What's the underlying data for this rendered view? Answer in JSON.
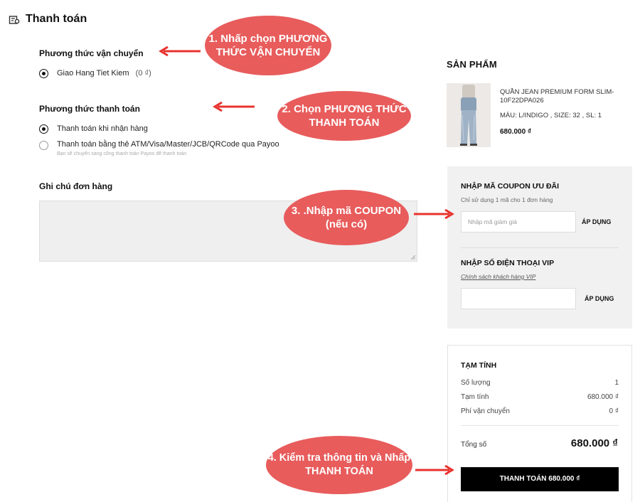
{
  "header": {
    "title": "Thanh toán",
    "icon": "payment-map-icon"
  },
  "shipping": {
    "title": "Phương thức vận chuyển",
    "option_label": "Giao Hang Tiet Kiem",
    "option_fee": "(0 ₫)"
  },
  "payment": {
    "title": "Phương thức thanh toán",
    "options": [
      {
        "label": "Thanh toán khi nhận hàng",
        "checked": true
      },
      {
        "label": "Thanh toán bằng thẻ ATM/Visa/Master/JCB/QRCode qua Payoo",
        "note": "Bạn sẽ chuyển sang cổng thanh toán Payoo để thanh toán",
        "checked": false
      }
    ]
  },
  "order_note": {
    "title": "Ghi chú đơn hàng"
  },
  "products": {
    "title": "SẢN PHẨM",
    "item": {
      "name": "QUẦN JEAN PREMIUM FORM SLIM-10F22DPA026",
      "meta": "MÀU: L/INDIGO , SIZE: 32 , SL: 1",
      "price": "680.000 ₫"
    }
  },
  "coupon": {
    "title": "NHẬP MÃ COUPON ƯU ĐÃI",
    "hint": "Chỉ sử dụng 1 mã cho 1 đơn hàng",
    "placeholder": "Nhập mã giảm giá",
    "apply_label": "ÁP DỤNG"
  },
  "vip": {
    "title": "NHẬP SỐ ĐIỆN THOẠI VIP",
    "link": "Chính sách khách hàng VIP",
    "apply_label": "ÁP DỤNG"
  },
  "summary": {
    "title": "TẠM TÍNH",
    "rows": [
      {
        "label": "Số lượng",
        "value": "1"
      },
      {
        "label": "Tạm tính",
        "value": "680.000 ₫"
      },
      {
        "label": "Phí vận chuyển",
        "value": "0 ₫"
      }
    ],
    "total_label": "Tổng số",
    "total_value": "680.000 ₫",
    "pay_button": "THANH TOÁN 680.000 ₫"
  },
  "callouts": {
    "step1": "1. Nhấp chọn PHƯƠNG THỨC VẬN CHUYỂN",
    "step2": "2. Chọn PHƯƠNG THỨC THANH TOÁN",
    "step3": "3. .Nhập mã COUPON (nếu có)",
    "step4": "4. Kiểm tra thông tin và Nhấp THANH TOÁN"
  },
  "colors": {
    "callout": "#e85c5c",
    "arrow": "#e8332f",
    "panel_bg": "#f1f1f1",
    "pay_button_bg": "#000000"
  }
}
